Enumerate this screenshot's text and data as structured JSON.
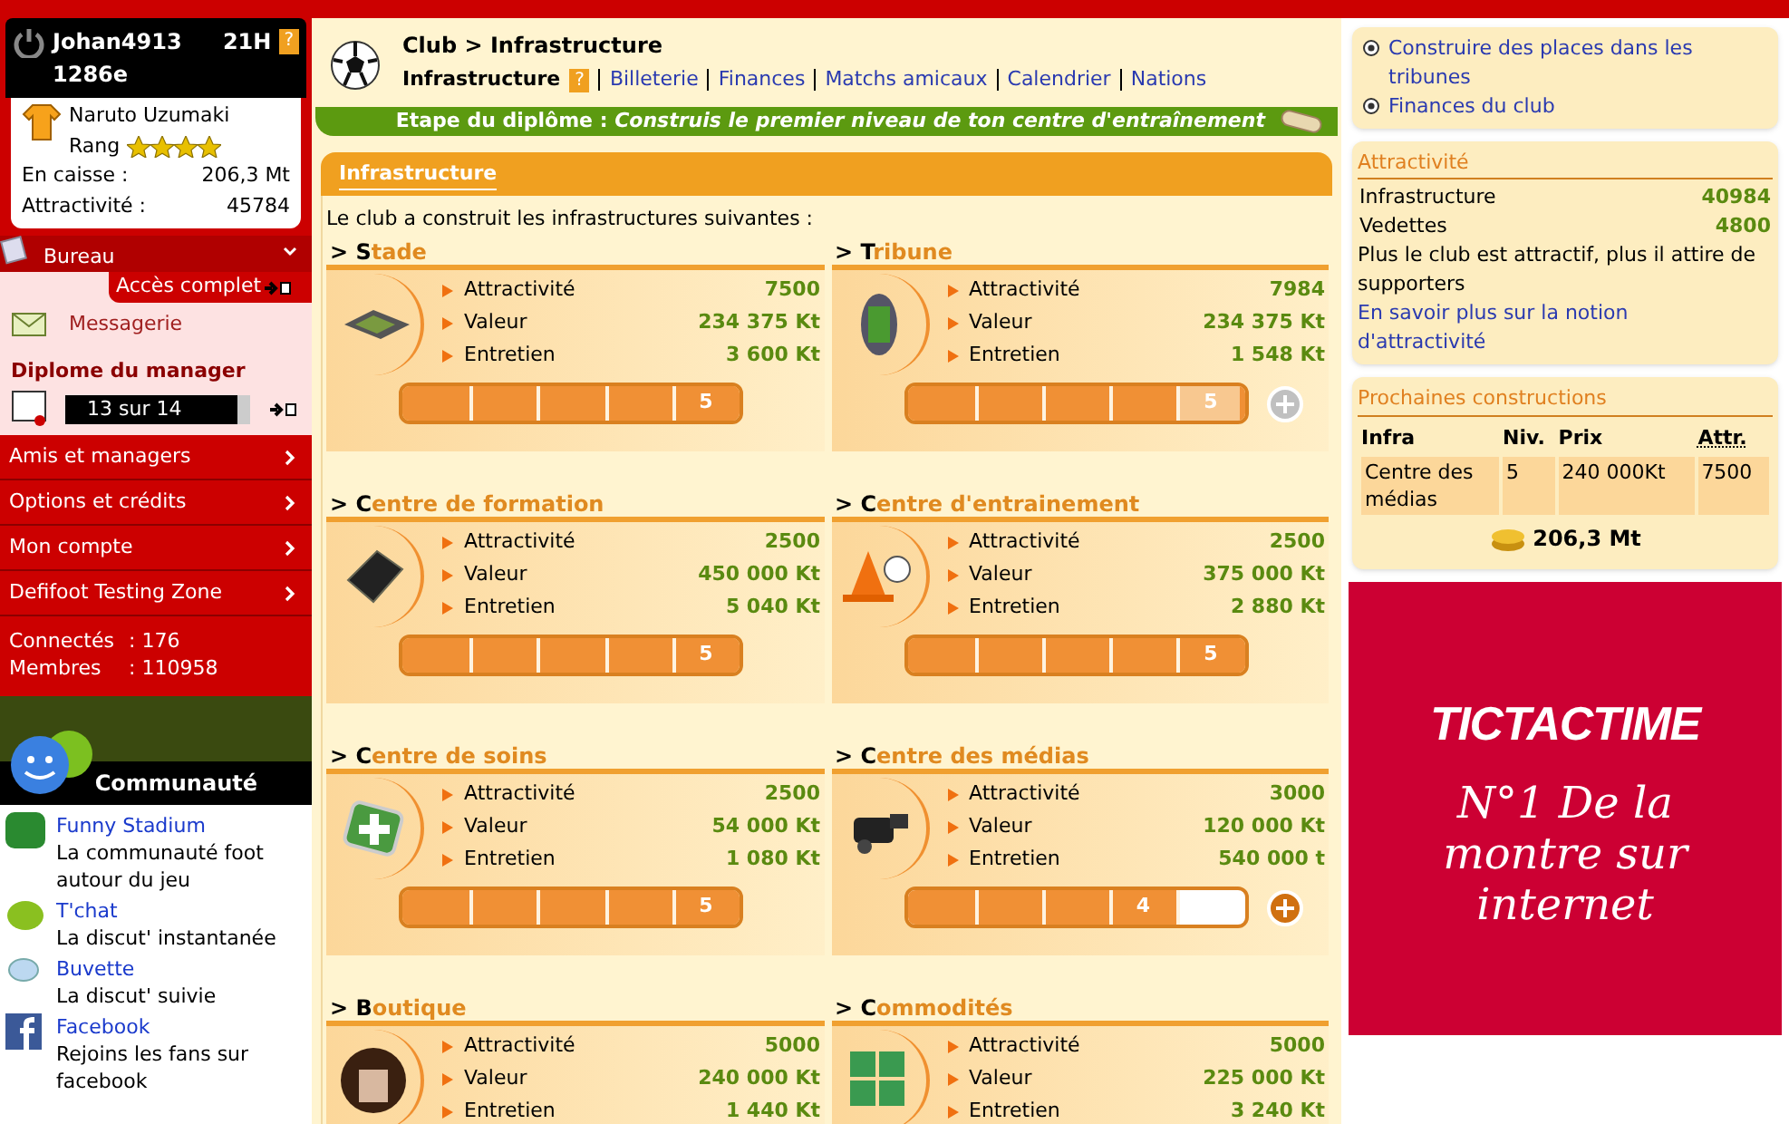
{
  "user": {
    "name": "Johan4913",
    "time": "21H",
    "help": "?",
    "points": "1286e",
    "manager": "Naruto Uzumaki",
    "rank_label": "Rang",
    "stars": 4,
    "cash_label": "En caisse :",
    "cash": "206,3 Mt",
    "attr_label": "Attractivité :",
    "attr": "45784"
  },
  "bureau": {
    "title": "Bureau",
    "access": "Accès complet",
    "messages": "Messagerie",
    "diploma_title": "Diplome du manager",
    "diploma_progress": "13 sur 14",
    "level": 0.93
  },
  "menu": [
    "Amis et managers",
    "Options et crédits",
    "Mon compte",
    "Defifoot Testing Zone"
  ],
  "stats": [
    {
      "label": "Connectés",
      "value": ": 176"
    },
    {
      "label": "Membres",
      "value": ": 110958"
    }
  ],
  "community": {
    "title": "Communauté",
    "items": [
      {
        "kind": "fs",
        "title": "Funny Stadium",
        "desc": "La communauté foot autour du jeu"
      },
      {
        "kind": "chat",
        "title": "T'chat",
        "desc": "La discut' instantanée"
      },
      {
        "kind": "bubble",
        "title": "Buvette",
        "desc": "La discut' suivie"
      },
      {
        "kind": "facebook",
        "title": "Facebook",
        "desc": "Rejoins les fans sur facebook"
      }
    ]
  },
  "header": {
    "breadcrumb": "Club > Infrastructure",
    "help": "?",
    "tabs": [
      {
        "label": "Infrastructure",
        "selected": true
      },
      {
        "label": "Billeterie",
        "selected": false
      },
      {
        "label": "Finances",
        "selected": false
      },
      {
        "label": "Matchs amicaux",
        "selected": false
      },
      {
        "label": "Calendrier",
        "selected": false
      },
      {
        "label": "Nations",
        "selected": false
      }
    ]
  },
  "diploma_step": {
    "label": "Etape du diplôme :",
    "text": "Construis le premier niveau de ton centre d'entraînement"
  },
  "panel": {
    "title": "Infrastructure",
    "intro": "Le club a construit les infrastructures suivantes :",
    "items": [
      {
        "kind": "stadium",
        "first": "> S",
        "rest": "tade",
        "stats": [
          {
            "label": "Attractivité",
            "value": "7500"
          },
          {
            "label": "Valeur",
            "value": "234 375 Kt"
          },
          {
            "label": "Entretien",
            "value": "3 600 Kt"
          }
        ],
        "level": 1,
        "reading": "5",
        "pending": false
      },
      {
        "kind": "stand",
        "first": "> T",
        "rest": "ribune",
        "stats": [
          {
            "label": "Attractivité",
            "value": "7984"
          },
          {
            "label": "Valeur",
            "value": "234 375 Kt"
          },
          {
            "label": "Entretien",
            "value": "1 548 Kt"
          }
        ],
        "level": 1,
        "reading": "5",
        "pending": true,
        "upgrade": {
          "enabled": false
        }
      },
      {
        "kind": "board",
        "first": "> C",
        "rest": "entre de formation",
        "stats": [
          {
            "label": "Attractivité",
            "value": "2500"
          },
          {
            "label": "Valeur",
            "value": "450 000 Kt"
          },
          {
            "label": "Entretien",
            "value": "5 040 Kt"
          }
        ],
        "level": 1,
        "reading": "5",
        "pending": false
      },
      {
        "kind": "cone",
        "first": "> C",
        "rest": "entre d'entrainement",
        "stats": [
          {
            "label": "Attractivité",
            "value": "2500"
          },
          {
            "label": "Valeur",
            "value": "375 000 Kt"
          },
          {
            "label": "Entretien",
            "value": "2 880 Kt"
          }
        ],
        "level": 1,
        "reading": "5",
        "pending": false
      },
      {
        "kind": "medic",
        "first": "> C",
        "rest": "entre de soins",
        "stats": [
          {
            "label": "Attractivité",
            "value": "2500"
          },
          {
            "label": "Valeur",
            "value": "54 000 Kt"
          },
          {
            "label": "Entretien",
            "value": "1 080 Kt"
          }
        ],
        "level": 1,
        "reading": "5",
        "pending": false
      },
      {
        "kind": "camera",
        "first": "> C",
        "rest": "entre des médias",
        "stats": [
          {
            "label": "Attractivité",
            "value": "3000"
          },
          {
            "label": "Valeur",
            "value": "120 000 Kt"
          },
          {
            "label": "Entretien",
            "value": "540 000 t"
          }
        ],
        "level": 0.8,
        "reading": "4",
        "pending": false,
        "upgrade": {
          "enabled": true
        }
      },
      {
        "kind": "bag",
        "first": "> B",
        "rest": "outique",
        "stats": [
          {
            "label": "Attractivité",
            "value": "5000"
          },
          {
            "label": "Valeur",
            "value": "240 000 Kt"
          },
          {
            "label": "Entretien",
            "value": "1 440 Kt"
          }
        ]
      },
      {
        "kind": "signs",
        "first": "> C",
        "rest": "ommodités",
        "stats": [
          {
            "label": "Attractivité",
            "value": "5000"
          },
          {
            "label": "Valeur",
            "value": "225 000 Kt"
          },
          {
            "label": "Entretien",
            "value": "3 240 Kt"
          }
        ]
      }
    ]
  },
  "links": [
    "Construire des places dans les tribunes",
    "Finances du club"
  ],
  "attractivity": {
    "title": "Attractivité",
    "rows": [
      {
        "label": "Infrastructure",
        "value": "40984"
      },
      {
        "label": "Vedettes",
        "value": "4800"
      }
    ],
    "note": "Plus le club est attractif, plus il attire de supporters",
    "link": "En savoir plus sur la notion d'attractivité"
  },
  "next": {
    "title": "Prochaines constructions",
    "columns": [
      "Infra",
      "Niv.",
      "Prix",
      "Attr."
    ],
    "rows": [
      [
        "Centre des médias",
        "5",
        "240 000Kt",
        "7500"
      ]
    ],
    "total": "206,3 Mt"
  },
  "ad": {
    "brand": "TICTACTIME",
    "tagline": "N°1 De la montre sur internet"
  }
}
